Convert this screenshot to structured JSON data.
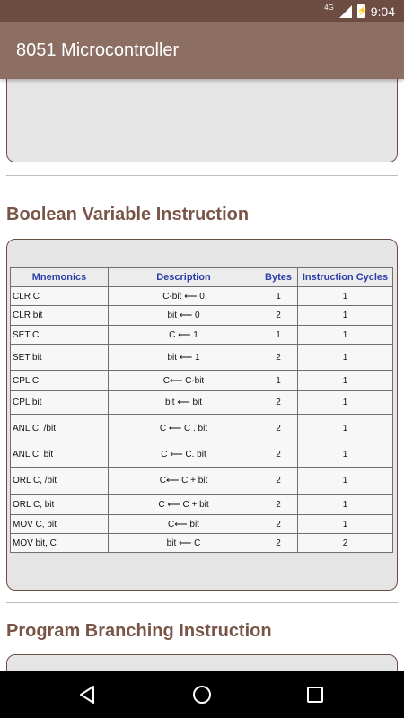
{
  "status": {
    "network": "4G",
    "battery": "⚡",
    "time": "9:04"
  },
  "appbar": {
    "title": "8051 Microcontroller"
  },
  "sections": [
    {
      "title": "Boolean Variable Instruction"
    },
    {
      "title": "Program Branching Instruction"
    }
  ],
  "table": {
    "headers": [
      "Mnemonics",
      "Description",
      "Bytes",
      "Instruction Cycles"
    ],
    "rows": [
      {
        "mnemonic": "CLR C",
        "description": "C-bit ⟵ 0",
        "bytes": "1",
        "cycles": "1"
      },
      {
        "mnemonic": "CLR bit",
        "description": "bit ⟵ 0",
        "bytes": "2",
        "cycles": "1"
      },
      {
        "mnemonic": "SET C",
        "description": "C ⟵ 1",
        "bytes": "1",
        "cycles": "1"
      },
      {
        "mnemonic": "SET bit",
        "description": "bit ⟵ 1",
        "bytes": "2",
        "cycles": "1"
      },
      {
        "mnemonic": "CPL C",
        "description": "C⟵  C-bit",
        "bytes": "1",
        "cycles": "1"
      },
      {
        "mnemonic": "CPL bit",
        "description": "bit ⟵ bit",
        "bytes": "2",
        "cycles": "1"
      },
      {
        "mnemonic": "ANL C, /bit",
        "description": "C ⟵ C . bit",
        "bytes": "2",
        "cycles": "1"
      },
      {
        "mnemonic": "ANL C, bit",
        "description": "C ⟵ C. bit",
        "bytes": "2",
        "cycles": "1"
      },
      {
        "mnemonic": "ORL C, /bit",
        "description": "C⟵ C + bit",
        "bytes": "2",
        "cycles": "1"
      },
      {
        "mnemonic": "ORL C, bit",
        "description": "C ⟵ C + bit",
        "bytes": "2",
        "cycles": "1"
      },
      {
        "mnemonic": "MOV C, bit",
        "description": "C⟵ bit",
        "bytes": "2",
        "cycles": "1"
      },
      {
        "mnemonic": "MOV bit, C",
        "description": "bit ⟵ C",
        "bytes": "2",
        "cycles": "2"
      }
    ]
  },
  "navbar": {
    "back_icon": "back-triangle-icon",
    "home_icon": "home-circle-icon",
    "recents_icon": "recents-square-icon"
  }
}
